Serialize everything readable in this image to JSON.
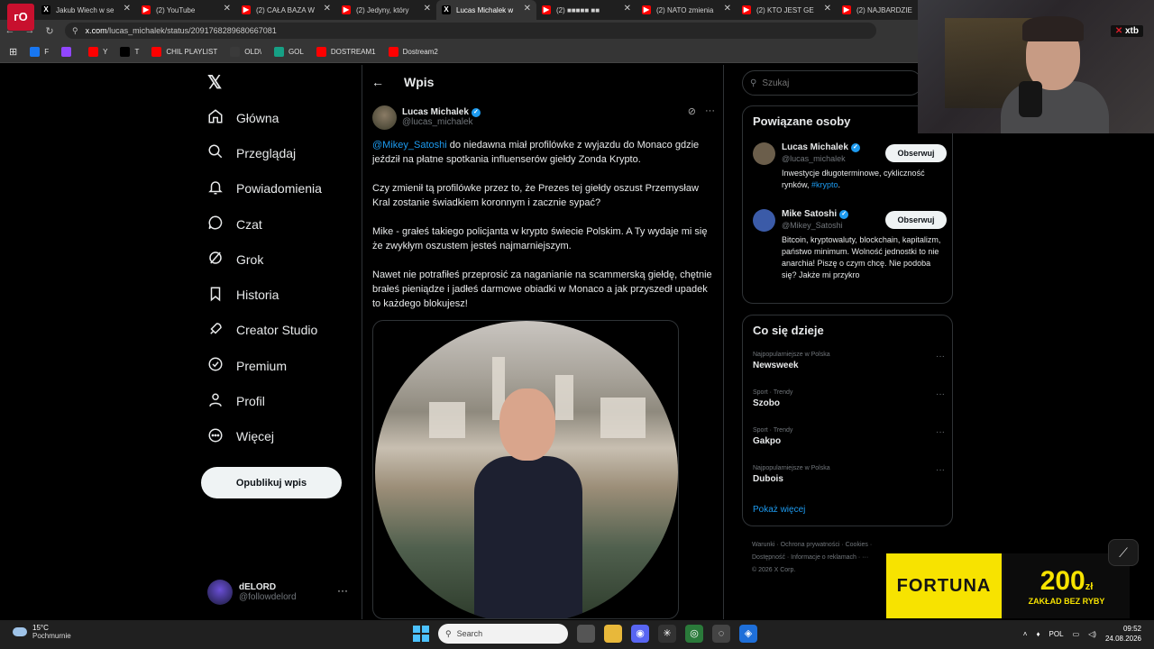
{
  "browser": {
    "tabs": [
      {
        "title": "Jakub Wiech w se",
        "icon": "x-logo-icon",
        "color": "#000000",
        "active": false
      },
      {
        "title": "(2) YouTube",
        "icon": "youtube-icon",
        "color": "#ff0000",
        "active": false
      },
      {
        "title": "(2) CAŁA BAZA W",
        "icon": "youtube-icon",
        "color": "#ff0000",
        "active": false
      },
      {
        "title": "(2) Jedyny, który",
        "icon": "youtube-icon",
        "color": "#ff0000",
        "active": false
      },
      {
        "title": "Lucas Michalek w",
        "icon": "x-logo-icon",
        "color": "#000000",
        "active": true
      },
      {
        "title": "(2) ■■■■■ ■■",
        "icon": "youtube-icon",
        "color": "#ff0000",
        "active": false
      },
      {
        "title": "(2) NATO zmienia",
        "icon": "youtube-icon",
        "color": "#ff0000",
        "active": false
      },
      {
        "title": "(2) KTO JEST GE",
        "icon": "youtube-icon",
        "color": "#ff0000",
        "active": false
      },
      {
        "title": "(2) NAJBARDZIE",
        "icon": "youtube-icon",
        "color": "#ff0000",
        "active": false
      }
    ],
    "url_domain": "x.com",
    "url_path": "/lucas_michalek/status/2091768289680667081",
    "bookmarks": [
      {
        "label": "F",
        "color": "#1877f2"
      },
      {
        "label": "",
        "color": "#9146ff"
      },
      {
        "label": "Y",
        "color": "#ff0000"
      },
      {
        "label": "T",
        "color": "#000000"
      },
      {
        "label": "CHIL PLAYLIST",
        "color": "#ff0000"
      },
      {
        "label": "OLD\\",
        "color": "#3a3a3a"
      },
      {
        "label": "GOL",
        "color": "#16a085"
      },
      {
        "label": "DOSTREAM1",
        "color": "#ff0000"
      },
      {
        "label": "Dostream2",
        "color": "#ff0000"
      }
    ]
  },
  "x": {
    "logo": "𝕏",
    "nav": [
      {
        "label": "Główna",
        "icon": "home-icon"
      },
      {
        "label": "Przeglądaj",
        "icon": "search-icon"
      },
      {
        "label": "Powiadomienia",
        "icon": "bell-icon"
      },
      {
        "label": "Czat",
        "icon": "chat-icon"
      },
      {
        "label": "Grok",
        "icon": "grok-icon"
      },
      {
        "label": "Historia",
        "icon": "bookmark-icon"
      },
      {
        "label": "Creator Studio",
        "icon": "rocket-icon"
      },
      {
        "label": "Premium",
        "icon": "premium-icon"
      },
      {
        "label": "Profil",
        "icon": "person-icon"
      },
      {
        "label": "Więcej",
        "icon": "more-circle-icon"
      }
    ],
    "post_button": "Opublikuj wpis",
    "account": {
      "name": "dELORD",
      "handle": "@followdelord"
    },
    "page_title": "Wpis",
    "tweet": {
      "author_name": "Lucas Michalek",
      "author_handle": "@lucas_michalek",
      "mention": "@Mikey_Satoshi",
      "p1_rest": " do niedawna miał profilówke z wyjazdu do Monaco gdzie jeździł na płatne spotkania influenserów giełdy Zonda Krypto.",
      "p2": "Czy zmienił tą profilówke przez to, że Prezes tej giełdy oszust Przemysław Kral zostanie świadkiem koronnym i zacznie sypać?",
      "p3": "Mike - grałeś takiego policjanta w krypto świecie Polskim. A Ty wydaje mi się że zwykłym oszustem jesteś najmarniejszym.",
      "p4": "Nawet nie potrafiłeś przeprosić za naganianie na scammerską giełdę, chętnie brałeś pieniądze i jadłeś darmowe obiadki w Monaco a jak przyszedł upadek to każdego blokujesz!"
    },
    "search_placeholder": "Szukaj",
    "related": {
      "title": "Powiązane osoby",
      "people": [
        {
          "name": "Lucas Michalek",
          "handle": "@lucas_michalek",
          "bio": "Inwestycje długoterminowe, cykliczność rynków, ",
          "bio_tag": "#krypto",
          "bio_end": ".",
          "button": "Obserwuj",
          "avatar_color": "#6b5e4b"
        },
        {
          "name": "Mike Satoshi",
          "handle": "@Mikey_Satoshi",
          "bio": "Bitcoin, kryptowaluty, blockchain, kapitalizm, państwo minimum. Wolność jednostki to nie anarchia! Piszę o czym chcę. Nie podoba się? Jakże mi przykro",
          "bio_tag": "",
          "bio_end": "",
          "button": "Obserwuj",
          "avatar_color": "#3b5ba8"
        }
      ]
    },
    "trends": {
      "title": "Co się dzieje",
      "items": [
        {
          "context": "Najpopularniejsze w Polska",
          "topic": "Newsweek"
        },
        {
          "context": "Sport · Trendy",
          "topic": "Szobo"
        },
        {
          "context": "Sport · Trendy",
          "topic": "Gakpo"
        },
        {
          "context": "Najpopularniejsze w Polska",
          "topic": "Dubois"
        }
      ],
      "show_more": "Pokaż więcej"
    },
    "footer": {
      "line1": "Warunki  ·  Ochrona prywatności  ·  Cookies  ·",
      "line2": "Dostępność  ·  Informacje o reklamach  ·  ···",
      "line3": "© 2026 X Corp."
    }
  },
  "overlay": {
    "xtb_label": "xtb",
    "ad_brand": "FORTUNA",
    "ad_amount": "200",
    "ad_currency": "zł",
    "ad_sub": "ZAKŁAD BEZ RYBY"
  },
  "taskbar": {
    "temp": "15°C",
    "weather": "Pochmurnie",
    "search": "Search",
    "lang": "POL",
    "time": "09:52",
    "date": "24.08.2026"
  }
}
